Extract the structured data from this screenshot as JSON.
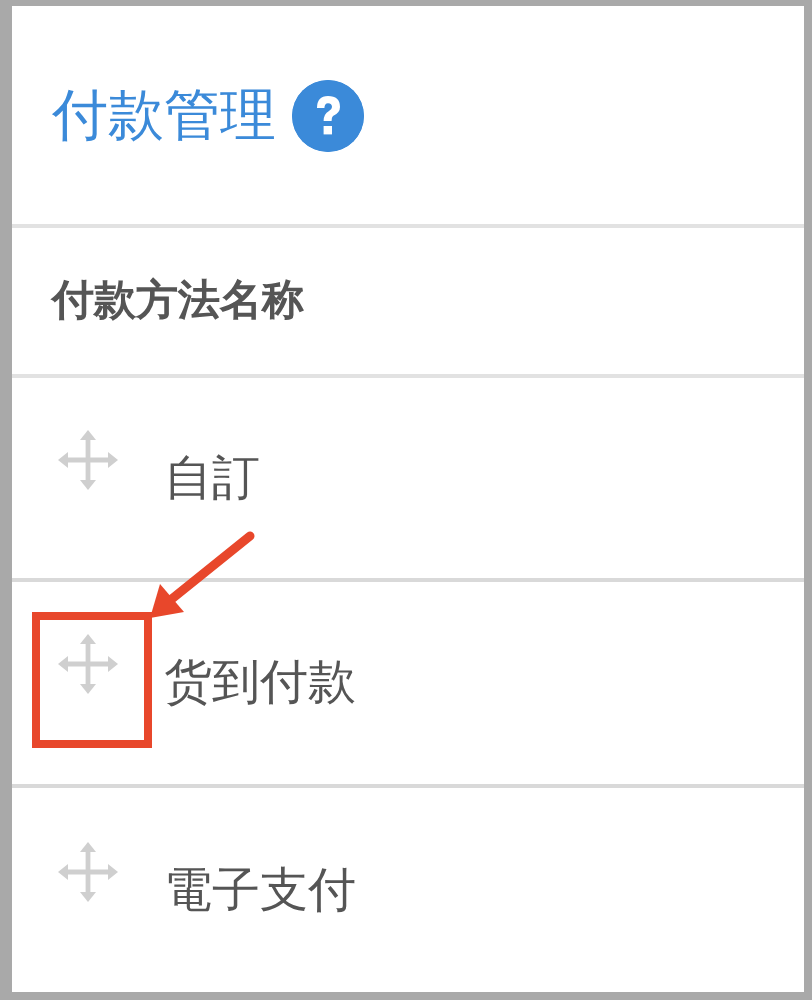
{
  "title": "付款管理",
  "table": {
    "column": "付款方法名称",
    "rows": [
      {
        "name": "自訂",
        "highlighted": false
      },
      {
        "name": "货到付款",
        "highlighted": true
      },
      {
        "name": "電子支付",
        "highlighted": false
      }
    ]
  }
}
